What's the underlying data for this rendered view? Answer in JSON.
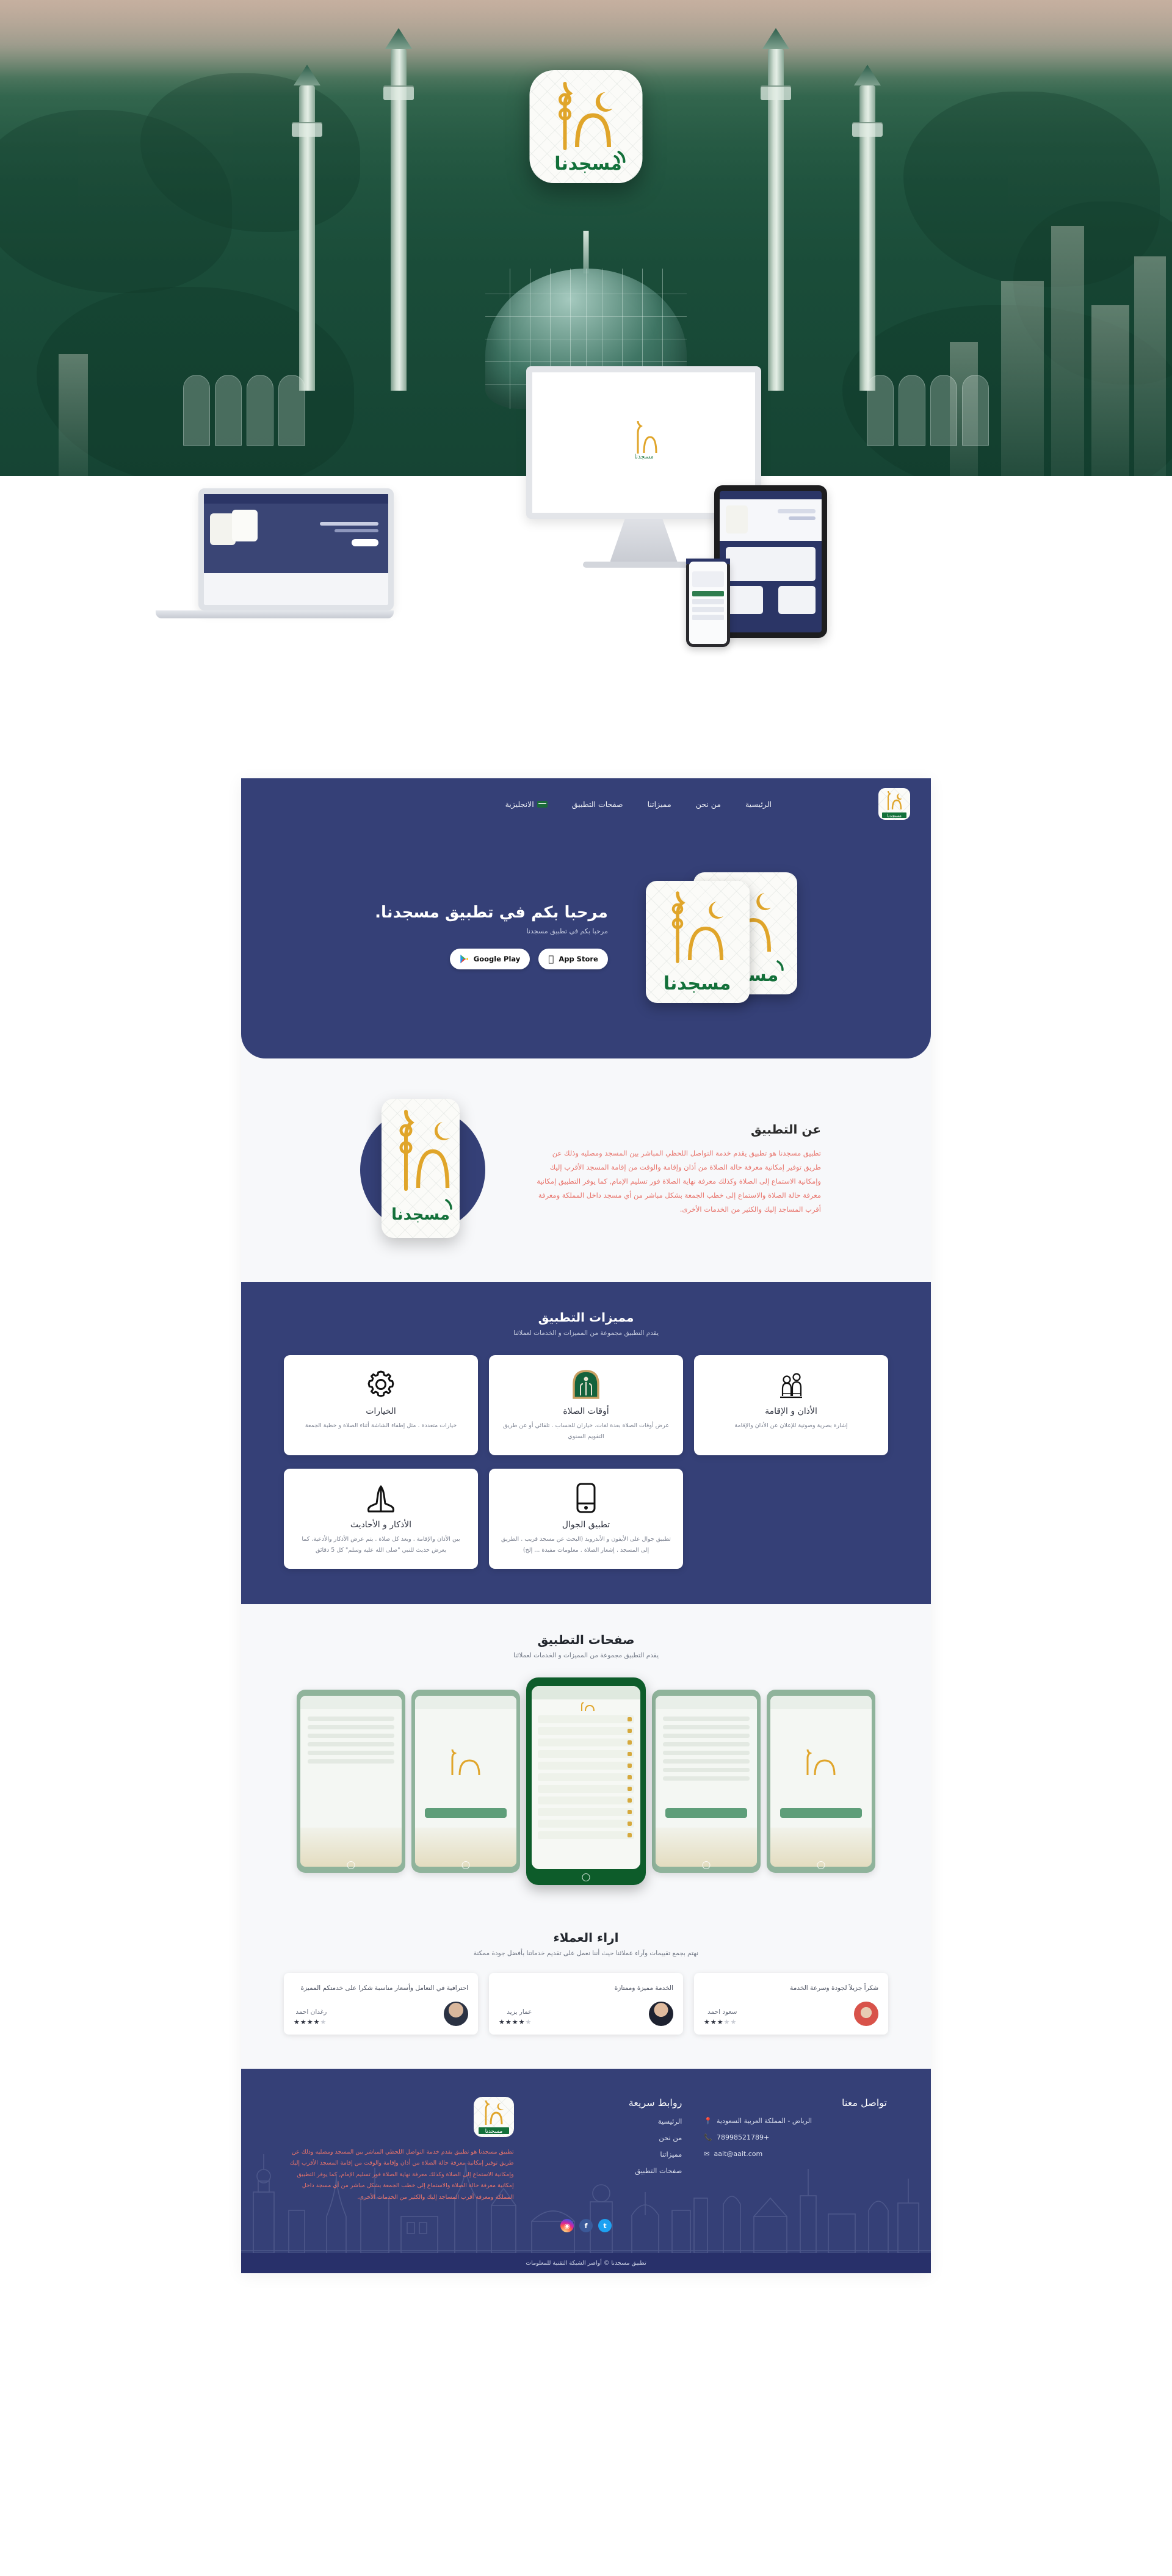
{
  "brand": {
    "name": "مسجدنا",
    "logo_alt": "شعار مسجدنا"
  },
  "nav": {
    "items": [
      {
        "label": "الرئيسية",
        "name": "nav-home"
      },
      {
        "label": "من نحن",
        "name": "nav-about"
      },
      {
        "label": "مميزاتنا",
        "name": "nav-features"
      },
      {
        "label": "صفحات التطبيق",
        "name": "nav-screens"
      },
      {
        "label": "الانجليزية",
        "name": "nav-language"
      }
    ]
  },
  "hero": {
    "title": "مرحبا بكم في تطبيق مسجدنا.",
    "subtitle": "مرحبا بكم في تطبيق مسجدنا",
    "app_store": "App Store",
    "google_play": "Google Play"
  },
  "about": {
    "title": "عن التطبيق",
    "paragraph": "تطبيق مسجدنا هو تطبيق يقدم خدمة التواصل اللحظي المباشر بين المسجد ومصليه وذلك عن طريق توفير إمكانية معرفة حالة الصلاة من أذان وإقامة والوقت من إقامة المسجد الأقرب إليك وإمكانية الاستماع إلى الصلاة وكذلك معرفة نهاية الصلاة فور تسليم الإمام, كما يوفر التطبيق إمكانية معرفة حالة الصلاة والاستماع إلى خطب الجمعة بشكل مباشر من أي مسجد داخل المملكة ومعرفة أقرب المساجد إليك والكثير من الخدمات الأخرى."
  },
  "features": {
    "title": "مميزات التطبيق",
    "subtitle": "يقدم التطبيق مجموعة من المميزات و الخدمات لعملائنا",
    "cards": [
      {
        "name": "الخيارات",
        "desc": "خيارات متعددة . مثل إطفاء الشاشة أثناء الصلاة و خطبة الجمعة",
        "icon": "gear-icon"
      },
      {
        "name": "أوقات الصلاة",
        "desc": "عرض أوقات الصلاة بعدة لغات. خياران للحساب . تلقائي أو عن طريق التقويم السنوي",
        "icon": "mosque-arch-icon"
      },
      {
        "name": "الأذان و الإقامة",
        "desc": "إشارة بصرية وصوتية للإعلان عن الأذان والإقامة",
        "icon": "praying-people-icon"
      },
      {
        "name": "الأذكار و الأحاديث",
        "desc": "بين الأذان والإقامة . وبعد كل صلاة . يتم عرض الأذكار والأدعية. كما يعرض حديث للنبي \"صلى الله عليه وسلم\" كل 5 دقائق",
        "icon": "praying-hands-icon"
      },
      {
        "name": "تطبيق الجوال",
        "desc": "تطبيق جوال على الأيفون و الأندرويد (البحث عن مسجد قريب . الطريق إلى المسجد . إشعار الصلاة . معلومات مفيدة ... إلخ)",
        "icon": "smartphone-icon"
      }
    ]
  },
  "screenshots": {
    "title": "صفحات التطبيق",
    "subtitle": "يقدم التطبيق مجموعة من المميزات و الخدمات لعملائنا",
    "count": 5
  },
  "reviews": {
    "title": "اراء العملاء",
    "subtitle": "نهتم بجمع تقييمات وآراء عملائنا حيث أننا نعمل على تقديم خدماتنا بأفضل جودة ممكنة",
    "cards": [
      {
        "text": "شكراً جزيلاً لجودة وسرعة الخدمة",
        "name": "سعود احمد",
        "rating": 3,
        "avatar": "a3"
      },
      {
        "text": "الخدمة مميزة وممتازة",
        "name": "عمار يزيد",
        "rating": 4,
        "avatar": "a2"
      },
      {
        "text": "احترافية في التعامل وأسعار مناسبة شكرا على خدمتكم المميزة",
        "name": "رغدان احمد",
        "rating": 4,
        "avatar": "a1"
      }
    ]
  },
  "footer": {
    "contact": {
      "heading": "تواصل معنا",
      "address": "الرياض - المملكة العربية السعودية",
      "phone": "+78998521789",
      "email": "aait@aait.com",
      "location_icon": "map-pin-icon",
      "phone_icon": "phone-icon",
      "email_icon": "envelope-icon"
    },
    "quick_links": {
      "heading": "روابط سريعة",
      "items": [
        "الرئيسية",
        "من نحن",
        "مميزاتنا",
        "صفحات التطبيق"
      ]
    },
    "about_text": "تطبيق مسجدنا هو تطبيق يقدم خدمة التواصل اللحظي المباشر بين المسجد ومصليه وذلك عن طريق توفير إمكانية معرفة حالة الصلاة من أذان وإقامة والوقت من إقامة المسجد الأقرب إليك وإمكانية الاستماع إلى الصلاة وكذلك معرفة نهاية الصلاة فور تسليم الإمام, كما يوفر التطبيق إمكانية معرفة حالة الصلاة والاستماع إلى خطب الجمعة بشكل مباشر من أي مسجد داخل المملكة ومعرفة أقرب المساجد إليك والكثير من الخدمات الأخرى.",
    "socials": [
      {
        "name": "twitter-icon",
        "glyph": "🐦"
      },
      {
        "name": "facebook-icon",
        "glyph": "f"
      },
      {
        "name": "instagram-icon",
        "glyph": "◉"
      }
    ],
    "copyright": "تطبيق مسجدنا © أواصر الشبكة التقنية للمعلومات"
  },
  "colors": {
    "navy": "#354077",
    "navy_dark": "#28306a",
    "gold": "#e0a52a",
    "green": "#0d5c2a",
    "coral": "#e8736b",
    "page_bg": "#f7f8fa"
  }
}
